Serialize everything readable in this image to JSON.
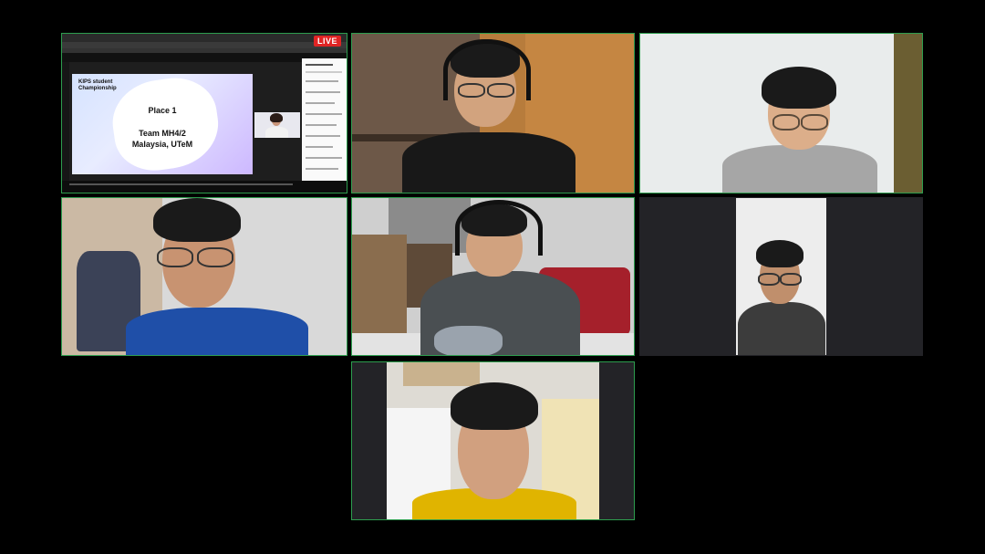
{
  "meeting": {
    "accent_color": "#2d9d4e",
    "background_color": "#000000"
  },
  "shared_screen": {
    "live_label": "LIVE",
    "slide": {
      "title": "KIPS student Championship",
      "place": "Place 1",
      "team_line1": "Team MH4/2",
      "team_line2": "Malaysia, UTeM"
    }
  },
  "participants": [
    {
      "tile": "shared-screen"
    },
    {
      "tile": "participant-1"
    },
    {
      "tile": "participant-2"
    },
    {
      "tile": "participant-3"
    },
    {
      "tile": "participant-4"
    },
    {
      "tile": "participant-5"
    },
    {
      "tile": "participant-6"
    }
  ]
}
